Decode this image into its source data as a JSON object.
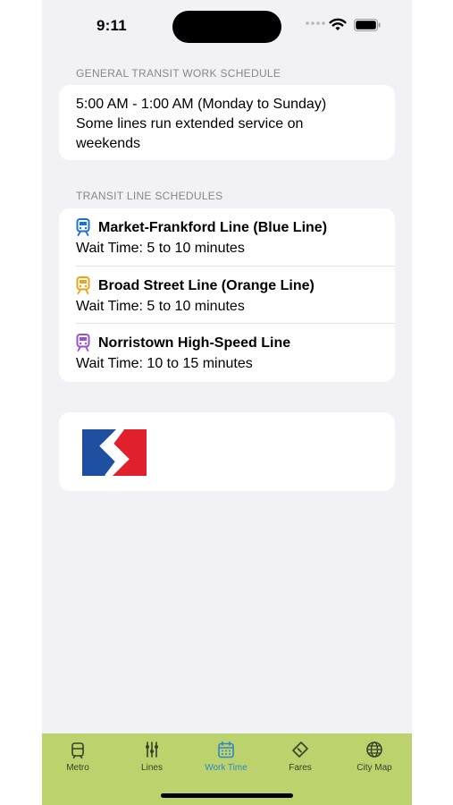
{
  "status_bar": {
    "time": "9:11"
  },
  "general": {
    "header": "GENERAL TRANSIT WORK SCHEDULE",
    "hours": "5:00 AM - 1:00 AM (Monday to Sunday)",
    "note_line1": "Some lines run extended service on",
    "note_line2": "weekends"
  },
  "lines": {
    "header": "TRANSIT LINE SCHEDULES",
    "items": [
      {
        "name": "Market-Frankford Line (Blue Line)",
        "wait": "Wait Time: 5 to 10 minutes",
        "icon": "train-icon",
        "color": "#1d6fd8"
      },
      {
        "name": "Broad Street Line (Orange Line)",
        "wait": "Wait Time: 5 to 10 minutes",
        "icon": "train-icon",
        "color": "#f0a21b"
      },
      {
        "name": "Norristown High-Speed Line",
        "wait": "Wait Time: 10 to 15 minutes",
        "icon": "train-icon",
        "color": "#9a4fd8"
      }
    ]
  },
  "logo": {
    "icon": "septa-logo",
    "colors": [
      "#1f4fa0",
      "#e0202c"
    ]
  },
  "tabs": [
    {
      "label": "Metro",
      "icon": "building-icon"
    },
    {
      "label": "Lines",
      "icon": "lines-icon"
    },
    {
      "label": "Work Time",
      "icon": "calendar-icon",
      "active": true
    },
    {
      "label": "Fares",
      "icon": "ticket-icon"
    },
    {
      "label": "City Map",
      "icon": "globe-icon"
    }
  ],
  "theme": {
    "accent": "#2f86c8",
    "tab_bar": "#bcd26c",
    "background": "#f2f2f6"
  }
}
